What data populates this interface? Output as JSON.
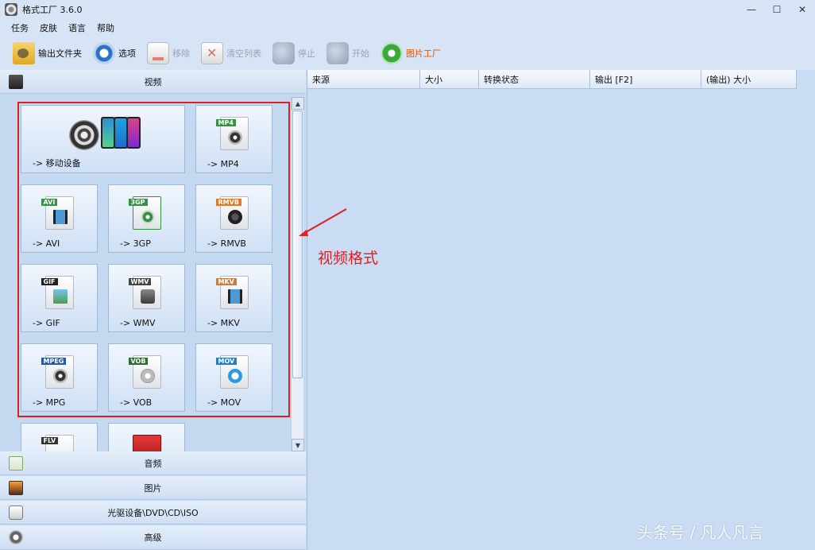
{
  "window": {
    "title": "格式工厂 3.6.0",
    "minimize": "—",
    "maximize": "☐",
    "close": "✕"
  },
  "menu": [
    "任务",
    "皮肤",
    "语言",
    "帮助"
  ],
  "toolbar": {
    "output_folder": "输出文件夹",
    "options": "选项",
    "remove": "移除",
    "clear_list": "清空列表",
    "stop": "停止",
    "start": "开始",
    "picture_factory": "图片工厂"
  },
  "categories": {
    "video": "视频",
    "audio": "音频",
    "image": "图片",
    "rom": "光驱设备\\DVD\\CD\\ISO",
    "advanced": "高级"
  },
  "video_formats": [
    {
      "label": "-> 移动设备",
      "tag": ""
    },
    {
      "label": "-> MP4",
      "tag": "MP4",
      "color": "#3a8f47"
    },
    {
      "label": "-> AVI",
      "tag": "AVI",
      "color": "#3a8f47"
    },
    {
      "label": "-> 3GP",
      "tag": "3GP",
      "color": "#3a8f47"
    },
    {
      "label": "-> RMVB",
      "tag": "RMVB",
      "color": "#e07a2a"
    },
    {
      "label": "-> GIF",
      "tag": "GIF",
      "color": "#222222"
    },
    {
      "label": "-> WMV",
      "tag": "WMV",
      "color": "#444444"
    },
    {
      "label": "-> MKV",
      "tag": "MKV",
      "color": "#c0804a"
    },
    {
      "label": "-> MPG",
      "tag": "MPEG",
      "color": "#2b5a9a"
    },
    {
      "label": "-> VOB",
      "tag": "VOB",
      "color": "#2d6a2d"
    },
    {
      "label": "-> MOV",
      "tag": "MOV",
      "color": "#2b7ac0"
    },
    {
      "label": "",
      "tag": "FLV",
      "color": "#333333"
    },
    {
      "label": "",
      "tag": "",
      "color": "#cc1111"
    }
  ],
  "table_columns": [
    "来源",
    "大小",
    "转换状态",
    "输出 [F2]",
    "(输出) 大小"
  ],
  "annotation": "视频格式",
  "watermark": "头条号 / 凡人凡言"
}
